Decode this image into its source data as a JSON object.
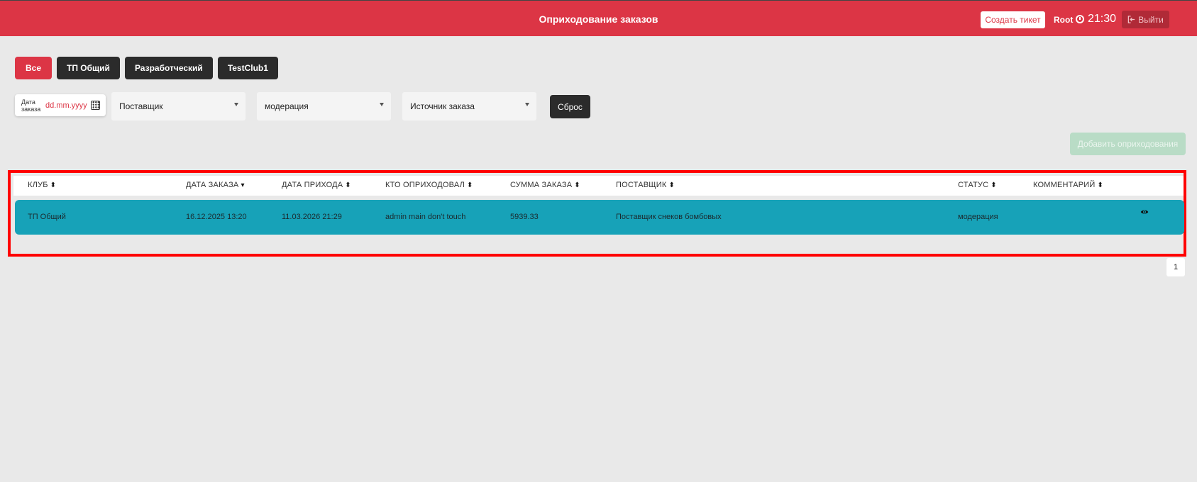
{
  "header": {
    "title": "Оприходование заказов",
    "create_ticket": "Создать тикет",
    "user": "Root",
    "time": "21:30",
    "logout": "Выйти"
  },
  "tabs": [
    {
      "label": "Все",
      "active": true
    },
    {
      "label": "ТП Общий",
      "active": false
    },
    {
      "label": "Разработческий",
      "active": false
    },
    {
      "label": "TestClub1",
      "active": false
    }
  ],
  "filters": {
    "date_label": "Дата заказа",
    "date_placeholder": "dd.mm.yyyy",
    "supplier": "Поставщик",
    "status": "модерация",
    "source": "Источник заказа",
    "reset": "Сброс"
  },
  "add_button": "Добавить оприходования",
  "table": {
    "columns": [
      "КЛУБ",
      "ДАТА ЗАКАЗА",
      "ДАТА ПРИХОДА",
      "КТО ОПРИХОДОВАЛ",
      "СУММА ЗАКАЗА",
      "ПОСТАВЩИК",
      "СТАТУС",
      "КОММЕНТАРИЙ"
    ],
    "rows": [
      {
        "club": "ТП Общий",
        "order_date": "16.12.2025 13:20",
        "arrival_date": "11.03.2026 21:29",
        "who": "admin main don't touch",
        "sum": "5939.33",
        "supplier": "Поставщик снеков бомбовых",
        "status": "модерация",
        "comment": ""
      }
    ]
  },
  "pagination": {
    "current_page": "1"
  },
  "colors": {
    "accent": "#dc3545",
    "row_highlight": "#17a2b8",
    "dark_button": "#2b2b2b",
    "outline": "#ff0000"
  }
}
